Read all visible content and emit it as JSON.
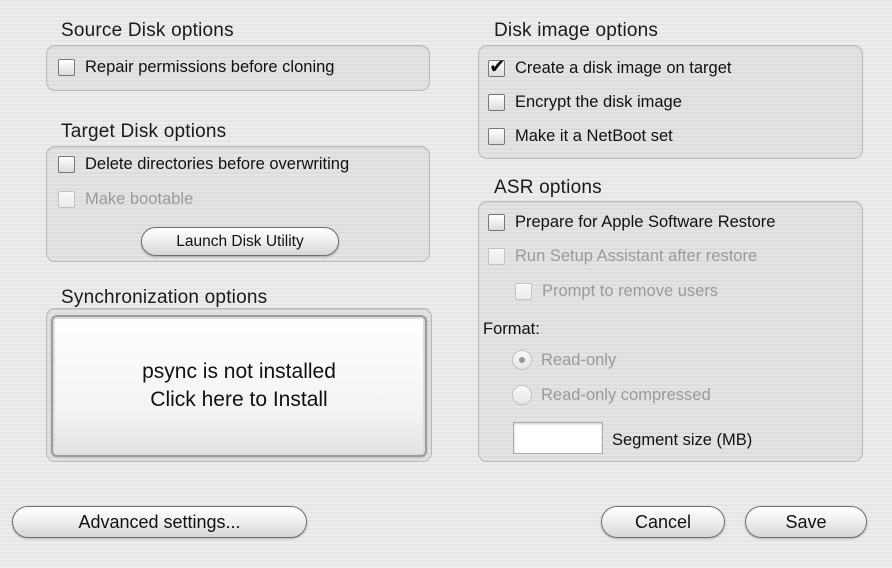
{
  "source_disk": {
    "title": "Source Disk options",
    "repair_permissions": {
      "label": "Repair permissions before cloning",
      "checked": false,
      "enabled": true
    }
  },
  "target_disk": {
    "title": "Target Disk options",
    "delete_directories": {
      "label": "Delete directories before overwriting",
      "checked": false,
      "enabled": true
    },
    "make_bootable": {
      "label": "Make bootable",
      "checked": false,
      "enabled": false
    },
    "launch_disk_utility": "Launch Disk Utility"
  },
  "sync": {
    "title": "Synchronization options",
    "line1": "psync is not installed",
    "line2": "Click here to Install"
  },
  "disk_image": {
    "title": "Disk image options",
    "create_image": {
      "label": "Create a disk image on target",
      "checked": true,
      "enabled": true
    },
    "encrypt_image": {
      "label": "Encrypt the disk image",
      "checked": false,
      "enabled": true
    },
    "netboot_set": {
      "label": "Make it a NetBoot set",
      "checked": false,
      "enabled": true
    }
  },
  "asr": {
    "title": "ASR options",
    "prepare_asr": {
      "label": "Prepare for Apple Software Restore",
      "checked": false,
      "enabled": true
    },
    "run_setup": {
      "label": "Run Setup Assistant after restore",
      "checked": false,
      "enabled": false
    },
    "prompt_remove": {
      "label": "Prompt to remove users",
      "checked": false,
      "enabled": false
    },
    "format_label": "Format:",
    "format_options": [
      {
        "label": "Read-only",
        "selected": true,
        "enabled": false
      },
      {
        "label": "Read-only compressed",
        "selected": false,
        "enabled": false
      }
    ],
    "segment_size_value": "",
    "segment_size_label": "Segment size (MB)"
  },
  "footer": {
    "advanced": "Advanced settings...",
    "cancel": "Cancel",
    "save": "Save"
  }
}
